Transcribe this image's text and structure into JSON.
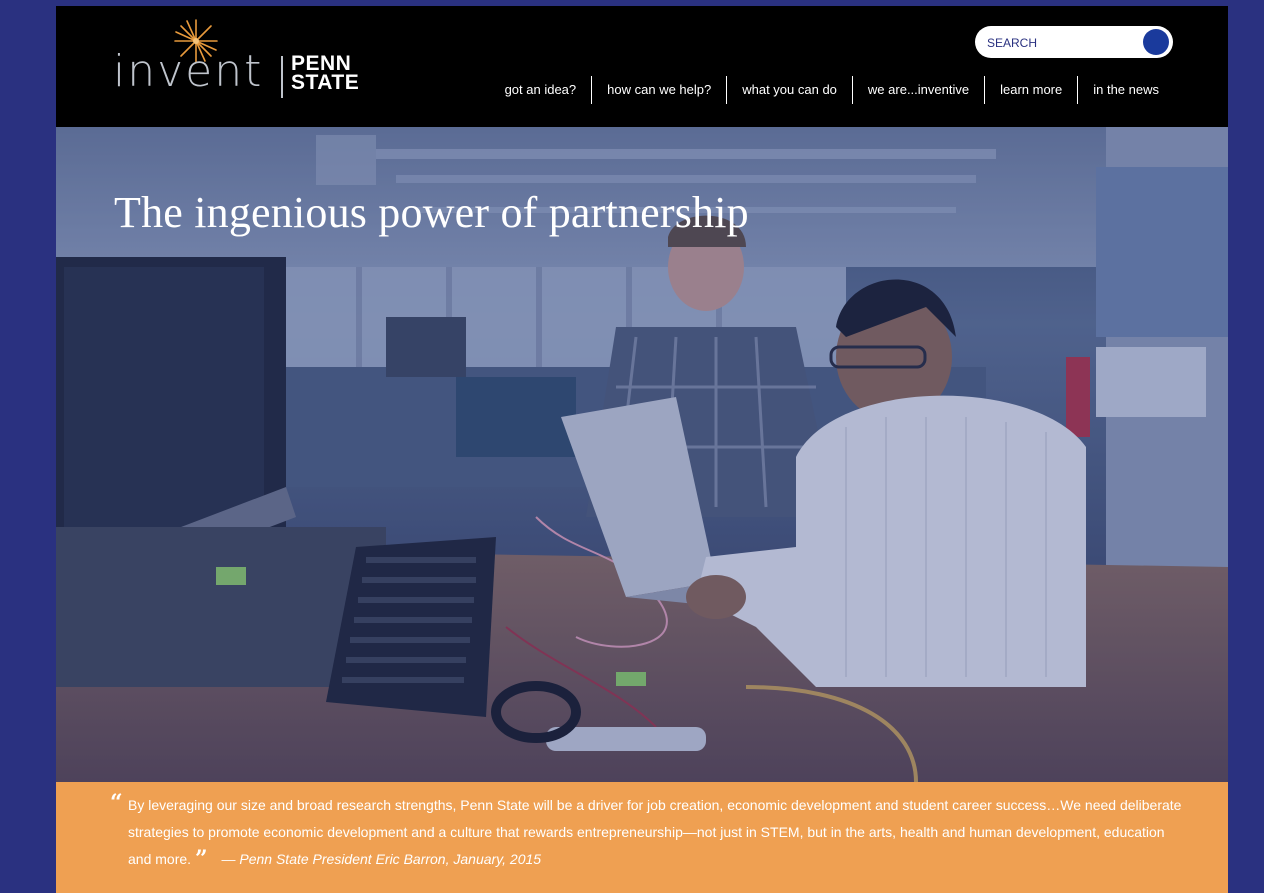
{
  "brand": {
    "logo_word": "invent",
    "logo_penn_line1": "PENN",
    "logo_penn_line2": "STATE",
    "star_color": "#e89a3c"
  },
  "search": {
    "placeholder": "SEARCH"
  },
  "nav": {
    "items": [
      "got an idea?",
      "how can we help?",
      "what you can do",
      "we are...inventive",
      "learn more",
      "in the news"
    ]
  },
  "hero": {
    "title": "The ingenious power of partnership"
  },
  "quote": {
    "open_mark": "“",
    "text": "By leveraging our size and broad research strengths, Penn State will be a driver for job creation, economic development and student career success…We need deliberate strategies to promote economic development and a culture that rewards entrepreneurship—not just in STEM, but in the arts, health and human development, education and more.",
    "close_mark": "”",
    "citation": "— Penn State President Eric Barron, January, 2015"
  },
  "colors": {
    "frame": "#2a3180",
    "quote_band": "#efa052",
    "search_button": "#1a3a9c"
  }
}
